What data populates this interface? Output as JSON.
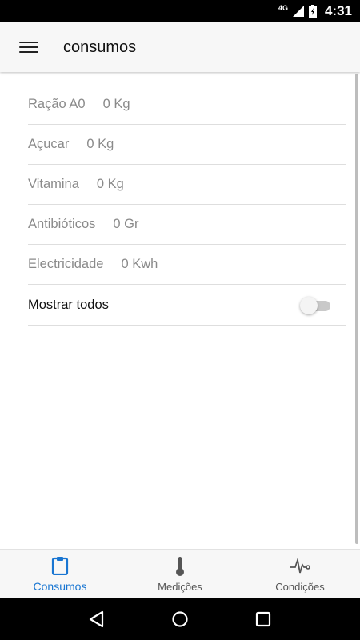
{
  "status_bar": {
    "network": "4G",
    "time": "4:31"
  },
  "app_bar": {
    "title": "consumos"
  },
  "items": [
    {
      "label": "Ração A0",
      "value": "0 Kg"
    },
    {
      "label": "Açucar",
      "value": "0 Kg"
    },
    {
      "label": "Vitamina",
      "value": "0 Kg"
    },
    {
      "label": "Antibióticos",
      "value": "0 Gr"
    },
    {
      "label": "Electricidade",
      "value": "0 Kwh"
    }
  ],
  "show_all": {
    "label": "Mostrar todos",
    "enabled": false
  },
  "bottom_nav": [
    {
      "label": "Consumos",
      "icon": "clipboard-icon",
      "active": true
    },
    {
      "label": "Medições",
      "icon": "thermometer-icon",
      "active": false
    },
    {
      "label": "Condições",
      "icon": "pulse-icon",
      "active": false
    }
  ],
  "colors": {
    "accent": "#1976d2",
    "muted_text": "#8a8a8a"
  }
}
